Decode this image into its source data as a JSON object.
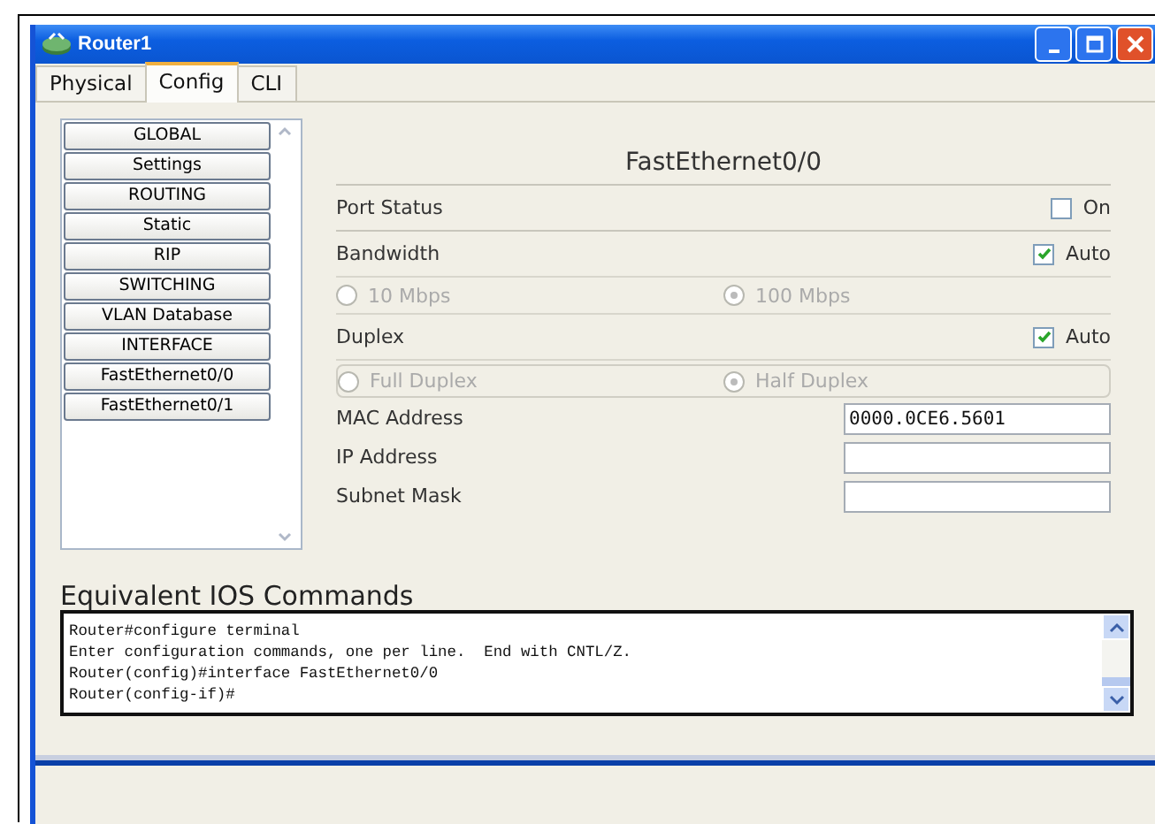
{
  "window": {
    "title": "Router1"
  },
  "tabs": [
    {
      "label": "Physical",
      "selected": false
    },
    {
      "label": "Config",
      "selected": true
    },
    {
      "label": "CLI",
      "selected": false
    }
  ],
  "sidebar": {
    "items": [
      {
        "label": "GLOBAL"
      },
      {
        "label": "Settings"
      },
      {
        "label": "ROUTING"
      },
      {
        "label": "Static"
      },
      {
        "label": "RIP"
      },
      {
        "label": "SWITCHING"
      },
      {
        "label": "VLAN Database"
      },
      {
        "label": "INTERFACE"
      },
      {
        "label": "FastEthernet0/0"
      },
      {
        "label": "FastEthernet0/1"
      }
    ]
  },
  "panel": {
    "title": "FastEthernet0/0",
    "port_status": {
      "label": "Port Status",
      "checkbox": {
        "label": "On",
        "checked": false
      }
    },
    "bandwidth": {
      "label": "Bandwidth",
      "checkbox": {
        "label": "Auto",
        "checked": true
      },
      "options": [
        {
          "label": "10 Mbps",
          "selected": false,
          "disabled": true
        },
        {
          "label": "100 Mbps",
          "selected": true,
          "disabled": true
        }
      ]
    },
    "duplex": {
      "label": "Duplex",
      "checkbox": {
        "label": "Auto",
        "checked": true
      },
      "options": [
        {
          "label": "Full Duplex",
          "selected": false,
          "disabled": true
        },
        {
          "label": "Half Duplex",
          "selected": true,
          "disabled": true
        }
      ]
    },
    "fields": [
      {
        "label": "MAC Address",
        "value": "0000.0CE6.5601"
      },
      {
        "label": "IP Address"
      },
      {
        "label": "Subnet Mask"
      }
    ]
  },
  "console": {
    "title": "Equivalent IOS Commands",
    "lines": [
      "Router#configure terminal",
      "Enter configuration commands, one per line.  End with CNTL/Z.",
      "Router(config)#interface FastEthernet0/0",
      "Router(config-if)#"
    ]
  }
}
